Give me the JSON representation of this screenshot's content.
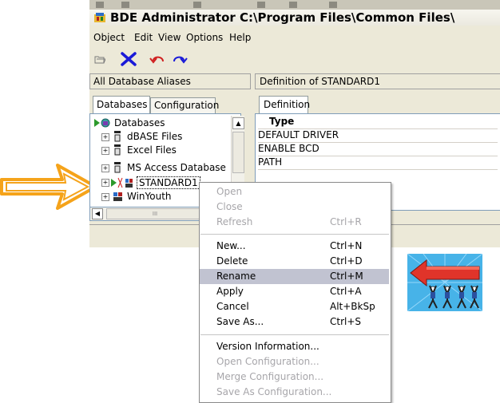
{
  "window": {
    "title": "BDE Administrator  C:\\Program Files\\Common Files\\"
  },
  "menubar": [
    "Object",
    "Edit",
    "View",
    "Options",
    "Help"
  ],
  "panels": {
    "left_header": "All Database Aliases",
    "right_header": "Definition of STANDARD1"
  },
  "tabs": {
    "databases": "Databases",
    "configuration": "Configuration",
    "definition": "Definition"
  },
  "tree": {
    "root": "Databases",
    "items": [
      "dBASE Files",
      "Excel Files",
      "MS Access Database",
      "STANDARD1",
      "WinYouth"
    ],
    "selected": "STANDARD1",
    "hscroll_label": "III"
  },
  "definition": {
    "header": "Type",
    "rows": [
      "DEFAULT DRIVER",
      "ENABLE BCD",
      "PATH"
    ]
  },
  "context_menu": {
    "items": [
      {
        "label": "Open",
        "shortcut": "",
        "disabled": true
      },
      {
        "label": "Close",
        "shortcut": "",
        "disabled": true
      },
      {
        "label": "Refresh",
        "shortcut": "Ctrl+R",
        "disabled": true
      },
      {
        "label": "New...",
        "shortcut": "Ctrl+N",
        "disabled": false
      },
      {
        "label": "Delete",
        "shortcut": "Ctrl+D",
        "disabled": false
      },
      {
        "label": "Rename",
        "shortcut": "Ctrl+M",
        "disabled": false,
        "highlighted": true
      },
      {
        "label": "Apply",
        "shortcut": "Ctrl+A",
        "disabled": false
      },
      {
        "label": "Cancel",
        "shortcut": "Alt+BkSp",
        "disabled": false
      },
      {
        "label": "Save As...",
        "shortcut": "Ctrl+S",
        "disabled": false
      },
      {
        "label": "Version Information...",
        "shortcut": "",
        "disabled": false
      },
      {
        "label": "Open Configuration...",
        "shortcut": "",
        "disabled": true
      },
      {
        "label": "Merge Configuration...",
        "shortcut": "",
        "disabled": true
      },
      {
        "label": "Save As Configuration...",
        "shortcut": "",
        "disabled": true
      }
    ]
  },
  "icons": {
    "pointer_arrow": "hollow-orange-arrow-icon",
    "clipart": "people-carrying-red-arrow-icon"
  },
  "colors": {
    "arrow_orange": "#f5a31a",
    "highlight": "#c1c3d1",
    "clip_red": "#e0342a",
    "clip_sky": "#47b3e8"
  }
}
